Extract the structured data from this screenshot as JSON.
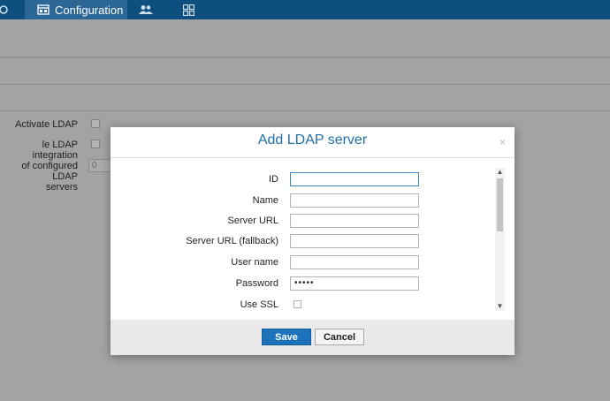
{
  "nav": {
    "items": [
      {
        "icon": "partial-gear-icon"
      },
      {
        "icon": "configuration-icon",
        "label": "Configuration"
      },
      {
        "icon": "users-icon"
      },
      {
        "icon": "dashboard-grid-icon"
      }
    ]
  },
  "background_form": {
    "activate_ldap_label": "Activate LDAP",
    "enable_ldap_label": "le LDAP integration",
    "configured_servers_label_1": "of configured LDAP",
    "configured_servers_label_2": "servers",
    "configured_servers_value": "0"
  },
  "modal": {
    "title": "Add LDAP server",
    "close_glyph": "×",
    "fields": [
      {
        "label": "ID",
        "value": ""
      },
      {
        "label": "Name",
        "value": ""
      },
      {
        "label": "Server URL",
        "value": ""
      },
      {
        "label": "Server URL (fallback)",
        "value": ""
      },
      {
        "label": "User name",
        "value": ""
      },
      {
        "label": "Password",
        "value": "•••••"
      },
      {
        "label": "Use SSL"
      }
    ],
    "save_label": "Save",
    "cancel_label": "Cancel"
  },
  "colors": {
    "topbar": "#0f4f7f",
    "accent": "#1f6ea8",
    "save_button": "#1c73bc",
    "overlay": "#a3a3a3"
  }
}
